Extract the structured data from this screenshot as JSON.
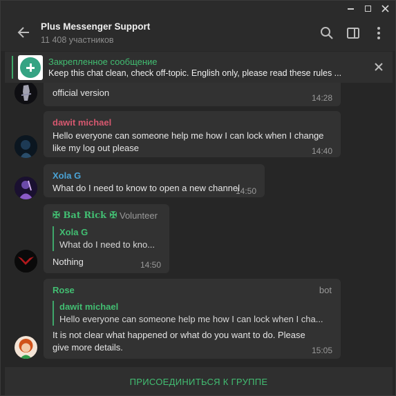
{
  "header": {
    "title": "Plus Messenger Support",
    "subtitle": "11 408 участников"
  },
  "pinned": {
    "title": "Закрепленное сообщение",
    "text": "Keep this chat clean, check off-topic. English only, please read these rules ..."
  },
  "messages": [
    {
      "text": "official version",
      "time": "14:28"
    },
    {
      "sender": "dawit michael",
      "sender_color": "#d6586f",
      "text_lines": [
        "Hello everyone can someone help me how I can lock when I change",
        "like my log out please"
      ],
      "time": "14:40"
    },
    {
      "sender": "Xola G",
      "sender_color": "#4aa3d6",
      "text": "What do I need to know to open a new channel",
      "time": "14:50"
    },
    {
      "sender": "✠ Bat Rick ✠",
      "sender_color": "#42be72",
      "role": "Volunteer",
      "reply_name": "Xola G",
      "reply_text": "What do I need to kno...",
      "text": "Nothing",
      "time": "14:50"
    },
    {
      "sender": "Rose",
      "sender_color": "#42be72",
      "role": "bot",
      "reply_name": "dawit michael",
      "reply_text": "Hello everyone can someone help me how I can lock when I cha...",
      "text_lines": [
        "It is not clear what happened or what do you want to do. Please",
        "give more details."
      ],
      "time": "15:05"
    }
  ],
  "join_button": "ПРИСОЕДИНИТЬСЯ К ГРУППЕ",
  "colors": {
    "accent": "#42be72",
    "background": "#262626",
    "bubble": "#323232"
  }
}
